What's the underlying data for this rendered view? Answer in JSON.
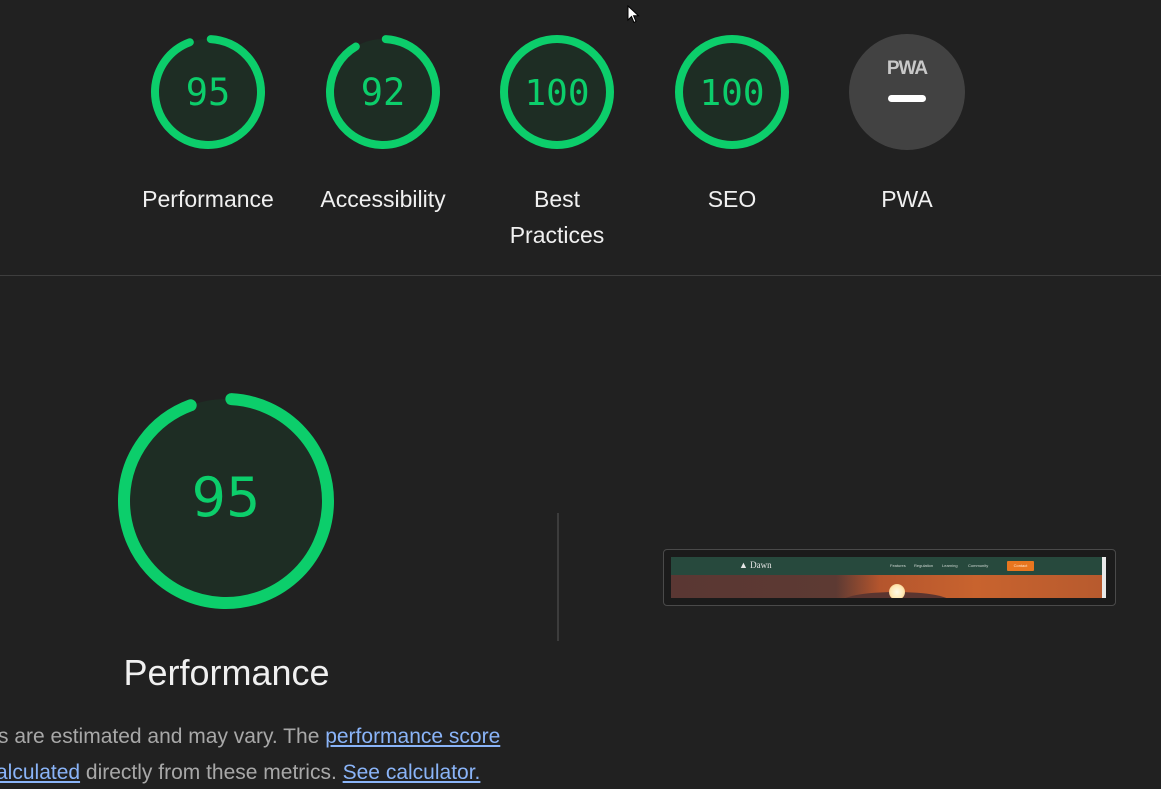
{
  "colors": {
    "pass": "#0cce6b",
    "pass_bg": "#1e2d24",
    "pwa_bg": "#424242",
    "page_bg": "#212121",
    "link": "#8ab4f8"
  },
  "categories": [
    {
      "label": "Performance",
      "score": 95,
      "display": "95"
    },
    {
      "label": "Accessibility",
      "score": 92,
      "display": "92"
    },
    {
      "label": "Best Practices",
      "score": 100,
      "display": "100"
    },
    {
      "label": "SEO",
      "score": 100,
      "display": "100"
    },
    {
      "label": "PWA",
      "score": null,
      "badge_text": "PWA",
      "icon": "pwa-dash-icon"
    }
  ],
  "main": {
    "title": "Performance",
    "score": 95,
    "score_display": "95"
  },
  "description": {
    "line1_prefix": "s are estimated and may vary. The ",
    "link1": "performance score",
    "line2_link_fragment": "alculated",
    "line2_middle": " directly from these metrics. ",
    "link2": "See calculator."
  },
  "thumbnail": {
    "logo": "Dawn",
    "nav_links": [
      "Features",
      "Regulation",
      "Learning",
      "Community"
    ],
    "cta": "Contact"
  }
}
